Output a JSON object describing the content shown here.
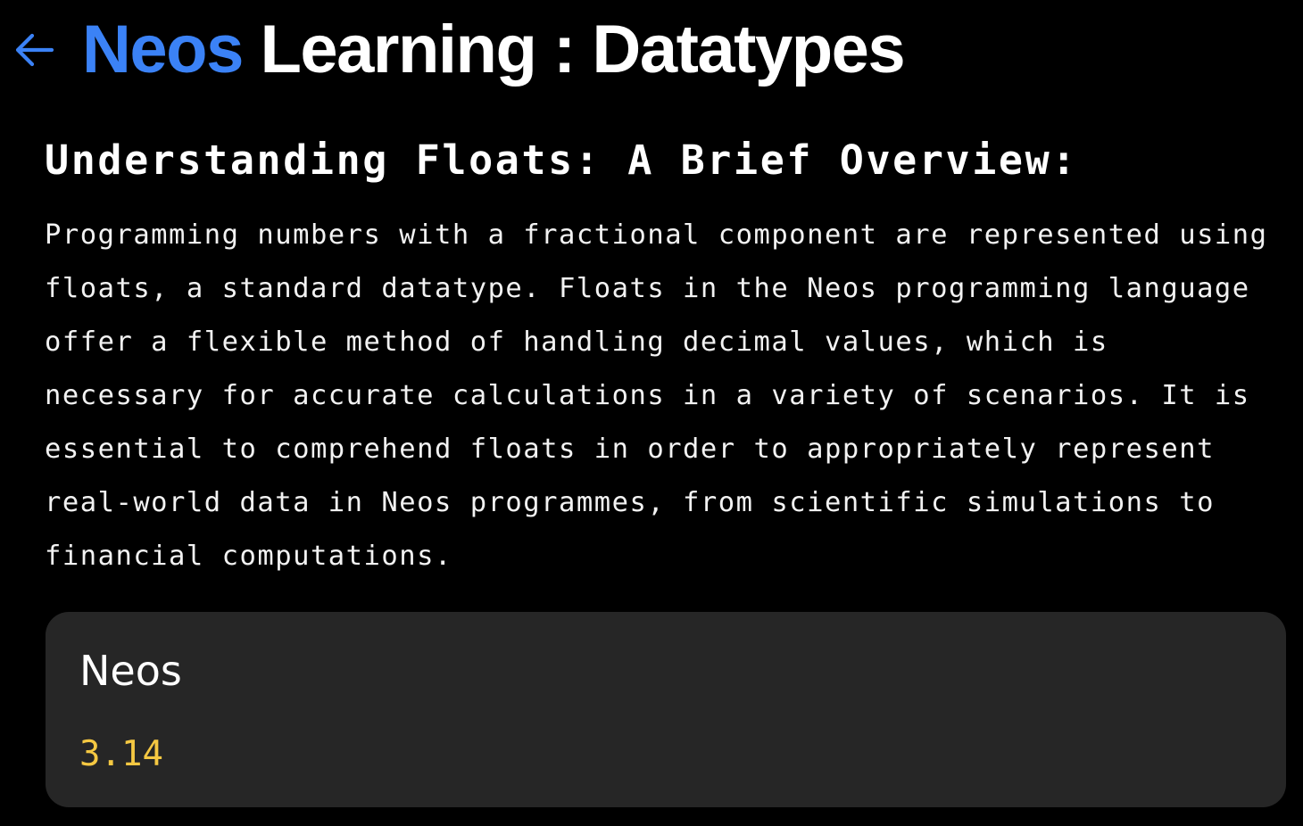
{
  "header": {
    "back_icon": "arrow-left-icon",
    "title_brand": "Neos",
    "title_rest": "Learning : Datatypes"
  },
  "section": {
    "heading": "Understanding Floats: A Brief Overview:",
    "body": "Programming numbers with a fractional component are represented using\nfloats, a standard datatype. Floats in the Neos programming language\noffer a flexible method of handling decimal values, which is\nnecessary for accurate calculations in a variety of scenarios. It is\nessential to comprehend floats in order to appropriately represent\nreal-world data in Neos programmes, from scientific simulations to\nfinancial computations."
  },
  "code_example": {
    "language": "Neos",
    "code": "3.14"
  },
  "colors": {
    "background": "#000000",
    "brand_blue": "#3b82f6",
    "card_background": "#262626",
    "code_value": "#f5c842",
    "text": "#ffffff"
  }
}
